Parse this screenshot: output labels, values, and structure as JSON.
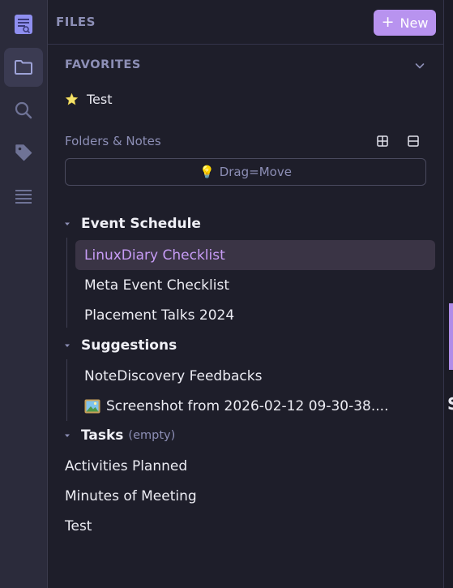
{
  "rail": {
    "items": [
      {
        "icon": "notebook-logo-icon"
      },
      {
        "icon": "folder-icon",
        "active": true
      },
      {
        "icon": "search-icon"
      },
      {
        "icon": "tag-icon"
      },
      {
        "icon": "list-icon"
      }
    ]
  },
  "header": {
    "title": "FILES",
    "new_button": {
      "icon": "+",
      "label": "New"
    }
  },
  "favorites": {
    "title": "FAVORITES",
    "items": [
      {
        "label": "Test",
        "icon": "star-icon"
      }
    ]
  },
  "tree_section": {
    "label": "Folders & Notes",
    "drag_hint": {
      "emoji": "💡",
      "text": "Drag=Move"
    }
  },
  "tree": {
    "folders": [
      {
        "name": "Event Schedule",
        "notes": [
          {
            "label": "LinuxDiary Checklist",
            "active": true
          },
          {
            "label": "Meta Event Checklist"
          },
          {
            "label": "Placement Talks 2024"
          }
        ]
      },
      {
        "name": "Suggestions",
        "notes": [
          {
            "label": "NoteDiscovery Feedbacks"
          },
          {
            "label": "Screenshot from 2026-02-12 09-30-38....",
            "icon": "image-icon"
          }
        ]
      },
      {
        "name": "Tasks",
        "empty_label": "(empty)"
      }
    ],
    "root_notes": [
      {
        "label": "Activities Planned"
      },
      {
        "label": "Minutes of Meeting"
      },
      {
        "label": "Test"
      }
    ]
  },
  "peek": {
    "letter": "S"
  },
  "colors": {
    "accent": "#b893ef",
    "active_text": "#c79cf6",
    "muted": "#8d8fb6",
    "panel_bg": "#1e1e2a",
    "rail_bg": "#2b2b3b"
  }
}
